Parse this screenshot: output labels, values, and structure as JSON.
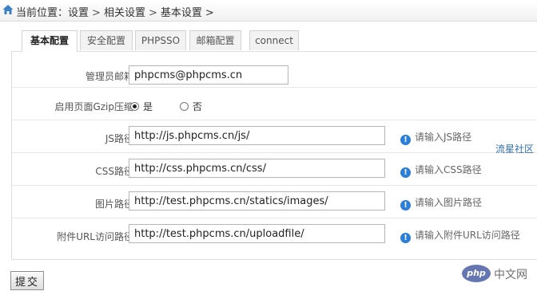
{
  "breadcrumb": {
    "prefix": "当前位置：",
    "items": [
      "设置",
      "相关设置",
      "基本设置"
    ],
    "separator": ">"
  },
  "tabs": [
    {
      "label": "基本配置",
      "active": true
    },
    {
      "label": "安全配置",
      "active": false
    },
    {
      "label": "PHPSSO",
      "active": false
    },
    {
      "label": "邮箱配置",
      "active": false
    },
    {
      "label": "connect",
      "active": false
    }
  ],
  "form": {
    "admin_email": {
      "label": "管理员邮箱",
      "value": "phpcms@phpcms.cn"
    },
    "gzip": {
      "label": "启用页面Gzip压缩",
      "options": [
        {
          "label": "是",
          "checked": true
        },
        {
          "label": "否",
          "checked": false
        }
      ]
    },
    "js_path": {
      "label": "JS路径",
      "value": "http://js.phpcms.cn/js/",
      "hint": "请输入JS路径"
    },
    "css_path": {
      "label": "CSS路径",
      "value": "http://css.phpcms.cn/css/",
      "hint": "请输入CSS路径"
    },
    "img_path": {
      "label": "图片路径",
      "value": "http://test.phpcms.cn/statics/images/",
      "hint": "请输入图片路径"
    },
    "upload_url": {
      "label": "附件URL访问路径",
      "value": "http://test.phpcms.cn/uploadfile/",
      "hint": "请输入附件URL访问路径"
    }
  },
  "side_link": "流星社区",
  "submit_label": "提交",
  "watermark": {
    "badge": "php",
    "text": "中文网"
  },
  "colors": {
    "accent": "#2b7fd9",
    "link": "#2b6fb6",
    "border": "#dedede"
  }
}
